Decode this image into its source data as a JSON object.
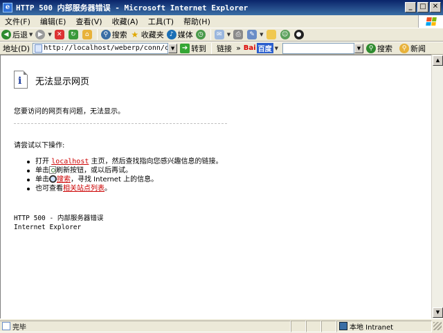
{
  "window": {
    "title": "HTTP 500 内部服务器错误 - Microsoft Internet Explorer"
  },
  "menu": [
    "文件(F)",
    "编辑(E)",
    "查看(V)",
    "收藏(A)",
    "工具(T)",
    "帮助(H)"
  ],
  "toolbar": {
    "back": "后退",
    "search": "搜索",
    "favorites": "收藏夹",
    "media": "媒体"
  },
  "addressbar": {
    "label": "地址(D)",
    "url": "http://localhost/weberp/conn/checkdata",
    "go": "转到",
    "links": "链接",
    "baidu_logo_1": "Bai",
    "baidu_logo_2": "百度",
    "baidu_search": "搜索",
    "news": "新闻"
  },
  "page": {
    "title": "无法显示网页",
    "description": "您要访问的网页有问题，无法显示。",
    "try_heading": "请尝试以下操作:",
    "opt1_pre": "打开 ",
    "opt1_link": "localhost",
    "opt1_post": " 主页，然后查找指向您感兴趣信息的链接。",
    "opt2_pre": "单击",
    "opt2_post": "刷新按钮，或以后再试。",
    "opt3_pre": "单击",
    "opt3_link": "搜索",
    "opt3_post": "，寻找 Internet 上的信息。",
    "opt4_pre": "也可查看",
    "opt4_link": "相关站点列表",
    "opt4_post": "。",
    "footer_line1": "HTTP 500 - 内部服务器错误",
    "footer_line2": "Internet Explorer"
  },
  "status": {
    "text": "完毕",
    "zone": "本地 Intranet"
  },
  "colors": {
    "titlebar": "#0a246a",
    "link": "#cc0000",
    "go": "#35a635"
  }
}
